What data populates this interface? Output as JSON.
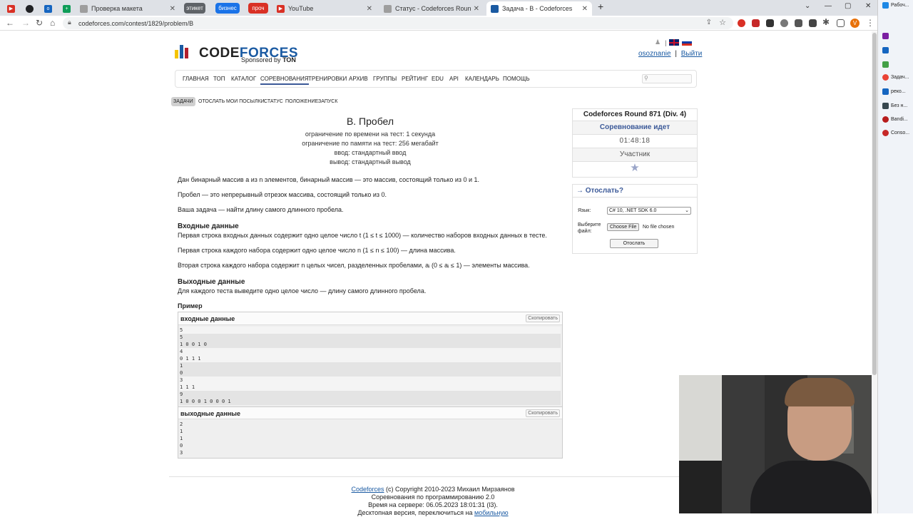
{
  "browser": {
    "tabs": [
      {
        "title": "",
        "icon_color": "#d93025"
      },
      {
        "title": "",
        "icon_color": "#202124"
      },
      {
        "title": "",
        "icon_color": "#1565c0"
      },
      {
        "title": "",
        "icon_color": "#0f9d58"
      },
      {
        "title": "Проверка макета",
        "icon_color": "#9e9e9e"
      },
      {
        "title": "YouTube",
        "icon_color": "#d93025"
      },
      {
        "title": "Статус - Codeforces Round 871",
        "icon_color": "#9e9e9e"
      },
      {
        "title": "Задача - B - Codeforces",
        "icon_color": "#1a5aa2"
      }
    ],
    "pills": [
      "этикет",
      "бизнес",
      "проч"
    ],
    "pill_colors": [
      "#5f6368",
      "#1a73e8",
      "#d93025"
    ],
    "url": "codeforces.com/contest/1829/problem/B",
    "profile_letter": "V"
  },
  "taskbar": {
    "items": [
      "Рабоч...",
      "",
      "",
      "",
      "Задач...",
      "реко...",
      "Без н...",
      "Bandi...",
      "Conso..."
    ]
  },
  "site": {
    "logo_text_a": "CODE",
    "logo_text_b": "FORCES",
    "sponsor_prefix": "Sponsored by",
    "sponsor_name": "TON",
    "user_link": "osoznanie",
    "separator": "|",
    "logout": "Выйти",
    "menu": [
      "Главная",
      "Топ",
      "Каталог",
      "Соревнования",
      "Тренировки",
      "Архив",
      "Группы",
      "Рейтинг",
      "Edu",
      "API",
      "Календарь",
      "Помощь"
    ],
    "subnav": [
      "Задачи",
      "Отослать",
      "Мои посылки",
      "Статус",
      "Положение",
      "Запуск"
    ]
  },
  "problem": {
    "title": "B. Пробел",
    "limits": [
      "ограничение по времени на тест: 1 секунда",
      "ограничение по памяти на тест: 256 мегабайт",
      "ввод: стандартный ввод",
      "вывод: стандартный вывод"
    ],
    "statement": [
      "Дан бинарный массив a из n элементов, бинарный массив — это массив, состоящий только из 0 и 1.",
      "Пробел — это непрерывный отрезок массива, состоящий только из 0.",
      "Ваша задача — найти длину самого длинного пробела."
    ],
    "input_title": "Входные данные",
    "input_text": [
      "Первая строка входных данных содержит одно целое число t (1 ≤ t ≤ 1000) — количество наборов входных данных в тесте.",
      "Первая строка каждого набора содержит одно целое число n (1 ≤ n ≤ 100) — длина массива.",
      "Вторая строка каждого набора содержит n целых чисел, разделенных пробелами, aᵢ (0 ≤ aᵢ ≤ 1) — элементы массива."
    ],
    "output_title": "Выходные данные",
    "output_text": "Для каждого теста выведите одно целое число — длину самого длинного пробела.",
    "example_label": "Пример",
    "input_label": "входные данные",
    "output_label": "выходные данные",
    "copy_label": "Скопировать",
    "input_lines": [
      "5",
      "5",
      "1 0 0 1 0",
      "4",
      "0 1 1 1",
      "1",
      "0",
      "3",
      "1 1 1",
      "9",
      "1 0 0 0 1 0 0 0 1"
    ],
    "input_groups": [
      0,
      1,
      1,
      2,
      2,
      3,
      3,
      4,
      4,
      5,
      5
    ],
    "output_lines": [
      "2",
      "1",
      "1",
      "0",
      "3"
    ]
  },
  "sidebar": {
    "contest_name": "Codeforces Round 871 (Div. 4)",
    "status": "Соревнование идет",
    "timer": "01:48:18",
    "role": "Участник",
    "submit_title": "→ Отослать?",
    "lang_label": "Язык:",
    "lang_value": "C# 10, .NET SDK 6.0",
    "file_label": "Выберите файл:",
    "choose_file": "Choose File",
    "no_file": "No file chosen",
    "submit_button": "Отослать"
  },
  "footer": {
    "link": "Codeforces",
    "copyright": "(c) Copyright 2010-2023 Михаил Мирзаянов",
    "line2": "Соревнования по программированию 2.0",
    "line3": "Время на сервере: 06.05.2023 18:01:31 (l3).",
    "line4_prefix": "Десктопная версия, переключиться на",
    "line4_link": "мобильную"
  },
  "colors": {
    "accent": "#1a5aa2",
    "nav_blue": "#3b5998"
  }
}
